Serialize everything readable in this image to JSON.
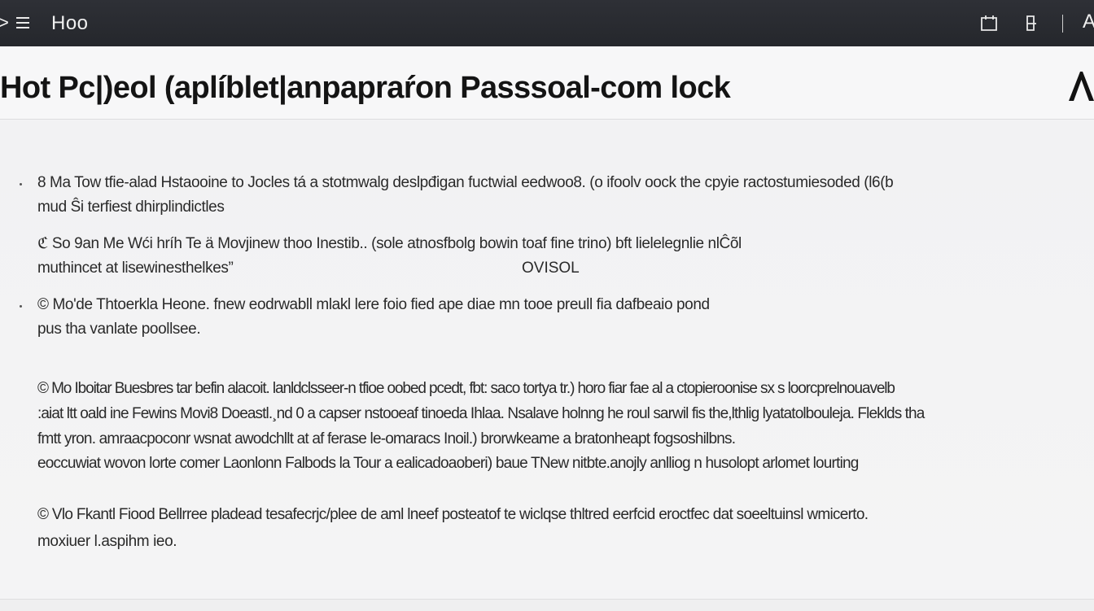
{
  "topbar": {
    "nav_glyph": ">",
    "app_title": "Hoo",
    "accent_letter": "A",
    "icons": [
      "chevron-right-icon",
      "menu-icon",
      "window-icon",
      "bookmark-icon",
      "logo-icon"
    ]
  },
  "header": {
    "title": "Hot Pc|)eol (aplíblet|anpapraŕon Passsoal-com lock"
  },
  "content": {
    "items": [
      {
        "lines": [
          "8  Ma  Tow tfie-alad  Hstaooine to  Jocles tá a stotmwalg deslpđigan fuctwial eedwoo8. (o ifoolv oock the cpyie ractostumiesoded (l6(b",
          "mud Ŝi terfiest  dhirplindictles"
        ],
        "tag": ""
      },
      {
        "lines": [
          "ℭ  So  9an  Me Wći hríh  Te  ä  Movjinew thoo Inestib.. (sole atnosfbolg  bowin toaf  fine trino) bft lielelegnlie nlĈõl",
          "muthincet at lisewinesthelkes”"
        ],
        "tag": "OVISOL"
      },
      {
        "lines": [
          "©  Mo'de  Thtoerkla Heone. fnew eodrwabll mlakl lere  foio fied ape  diae  mn tooe preull fia dafbeaio pond",
          "pus tha vanlate  poollsee."
        ],
        "tag": ""
      },
      {
        "lines": [
          "©  Mo  Iboitar  Buesbres  tar befin alacoit.  lanldclsseer-n tfioe oobed pcedt, fbt:  saco  tortya tr.)  horo fiar  fae  al a ctopieroonise sx s  loorcprelnouavelb",
          ":aiat ltt oald ine  Fewins  Movi8  Doeastl.¸nd 0  a  capser  nstooeaf tinoeda Ihlaa. Nsalave holnng he roul sarwil fis the,lthlig lyatatolbouleja. Fleklds tha",
          "fmtt yron.  amraacpoconr wsnat awodchllt at af ferase  le-omaracs  Inoil.) brorwkeame  a  bratonheapt  fogsoshilbns.",
          "eoccuwiat wovon lorte comer  Laonlonn Falbods  la Tour a ealicadoaoberi)  baue  TNew nitbte.anojly anlliog  n husolopt arlomet lourting"
        ],
        "tag": ""
      },
      {
        "lines": [
          "©  Vlo  Fkantl Fiood  Bellrree pladead tesafecrjc/plee  de  aml lneef  posteatof te wiclqse thltred eerfcid eroctfec dat soeeltuinsl wmicerto.",
          "moxiuer  l.aspihm ieo."
        ],
        "tag": ""
      }
    ]
  }
}
